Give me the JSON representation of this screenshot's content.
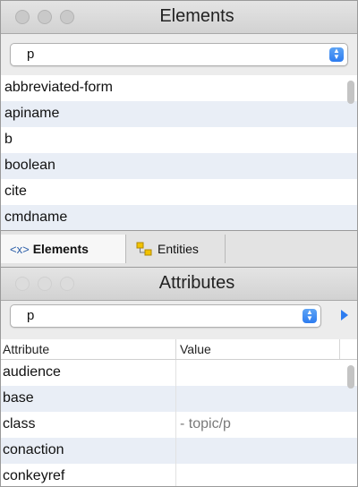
{
  "elements_panel": {
    "title": "Elements",
    "filter_value": "p",
    "items": [
      "abbreviated-form",
      "apiname",
      "b",
      "boolean",
      "cite",
      "cmdname"
    ]
  },
  "tabs": {
    "elements_glyph": "<x>",
    "elements_label": "Elements",
    "entities_label": "Entities"
  },
  "attributes_panel": {
    "title": "Attributes",
    "filter_value": "p",
    "columns": [
      "Attribute",
      "Value"
    ],
    "rows": [
      {
        "attribute": "audience",
        "value": ""
      },
      {
        "attribute": "base",
        "value": ""
      },
      {
        "attribute": "class",
        "value": "- topic/p"
      },
      {
        "attribute": "conaction",
        "value": ""
      },
      {
        "attribute": "conkeyref",
        "value": ""
      }
    ]
  },
  "colors": {
    "accent": "#2d7cf0",
    "alt_row": "#e9eef6"
  }
}
